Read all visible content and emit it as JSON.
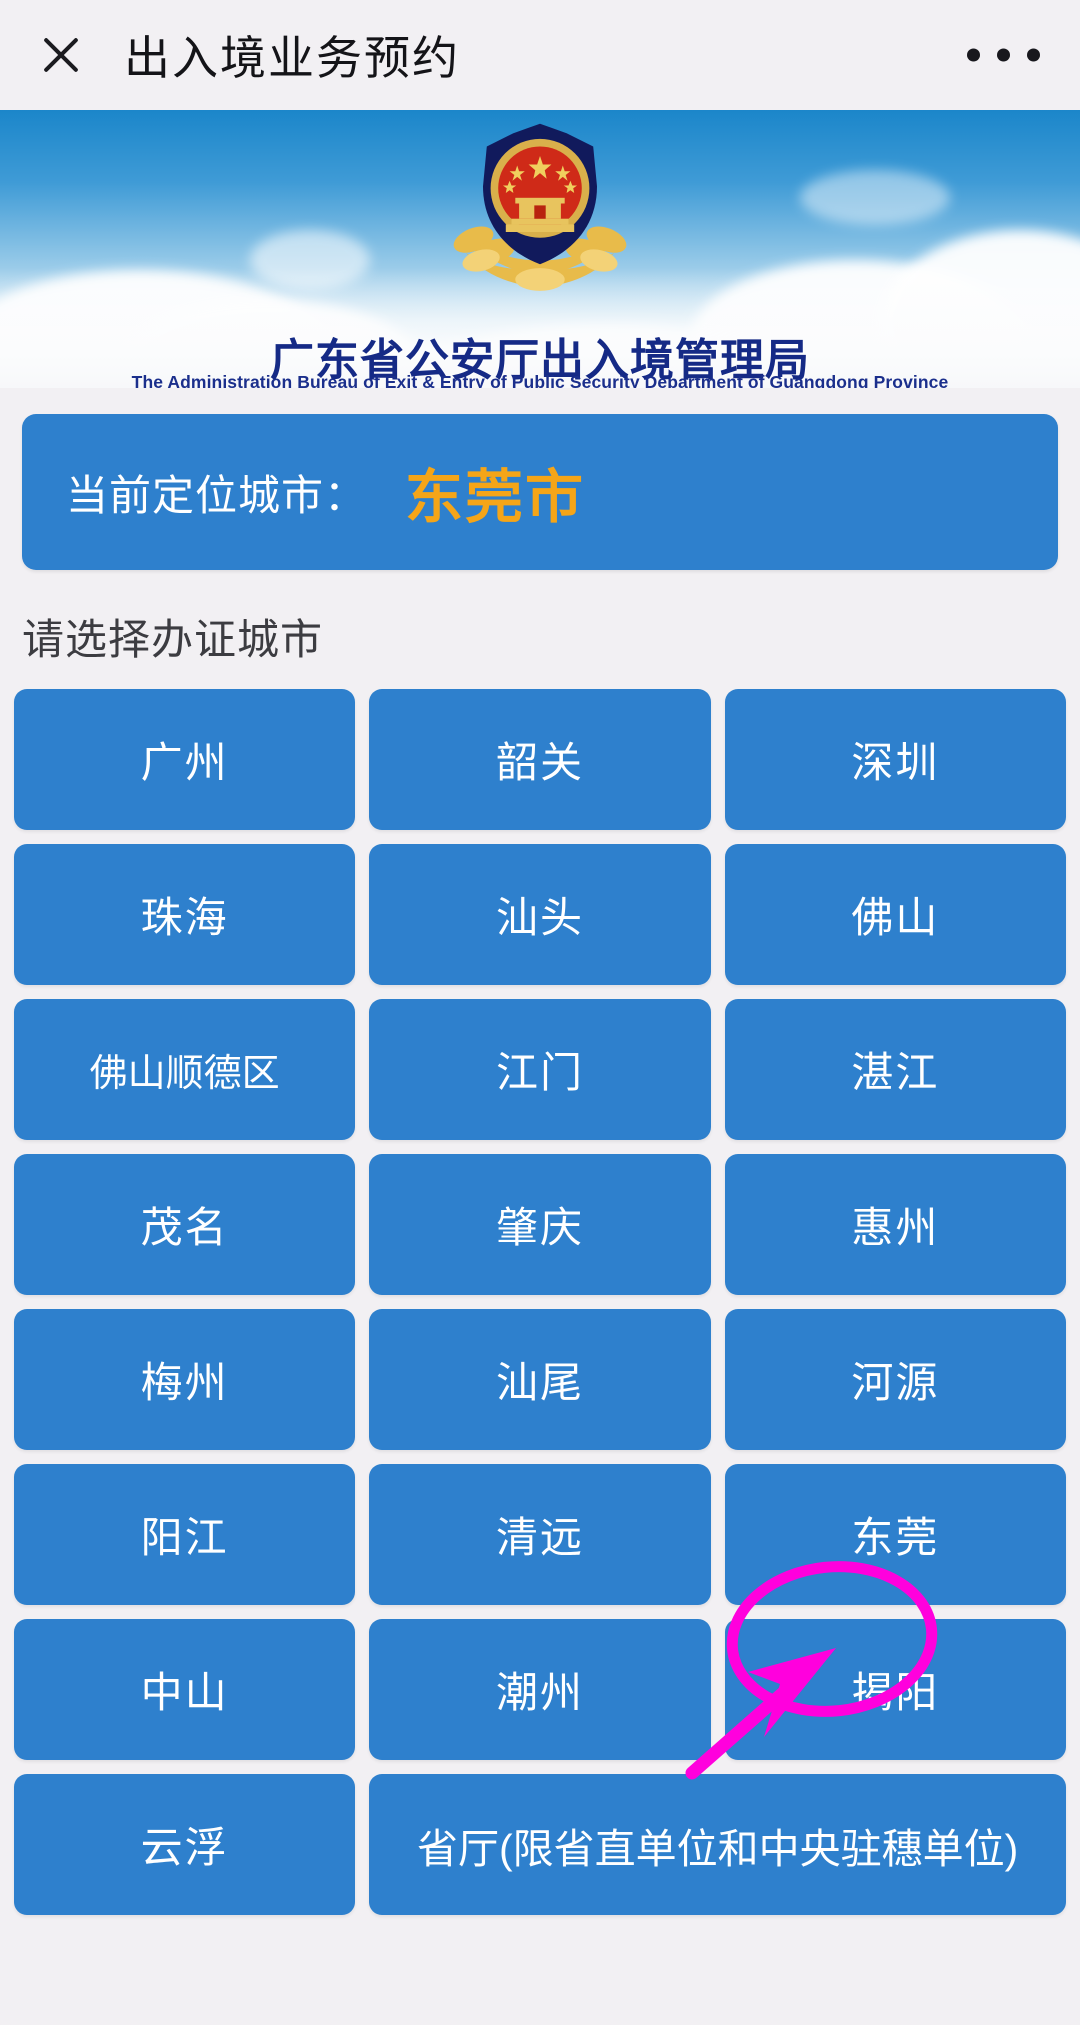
{
  "header": {
    "close_icon": "close-icon",
    "title": "出入境业务预约",
    "more_icon": "more-options-icon"
  },
  "banner": {
    "emblem_icon": "police-emblem-icon",
    "org_name_cn": "广东省公安厅出入境管理局",
    "org_name_en": "The Administration Bureau of Exit & Entry of Public Security Department of Guangdong Province",
    "sky_top_color": "#1b86ca",
    "sky_bottom_color": "#f7fafc"
  },
  "location": {
    "label": "当前定位城市：",
    "city": "东莞市",
    "bar_color": "#2e80cd",
    "city_color": "#f5a518"
  },
  "section": {
    "title": "请选择办证城市"
  },
  "cities": [
    {
      "label": "广州",
      "wide": false
    },
    {
      "label": "韶关",
      "wide": false
    },
    {
      "label": "深圳",
      "wide": false
    },
    {
      "label": "珠海",
      "wide": false
    },
    {
      "label": "汕头",
      "wide": false
    },
    {
      "label": "佛山",
      "wide": false
    },
    {
      "label": "佛山顺德区",
      "wide": false
    },
    {
      "label": "江门",
      "wide": false
    },
    {
      "label": "湛江",
      "wide": false
    },
    {
      "label": "茂名",
      "wide": false
    },
    {
      "label": "肇庆",
      "wide": false
    },
    {
      "label": "惠州",
      "wide": false
    },
    {
      "label": "梅州",
      "wide": false
    },
    {
      "label": "汕尾",
      "wide": false
    },
    {
      "label": "河源",
      "wide": false
    },
    {
      "label": "阳江",
      "wide": false
    },
    {
      "label": "清远",
      "wide": false
    },
    {
      "label": "东莞",
      "wide": false
    },
    {
      "label": "中山",
      "wide": false
    },
    {
      "label": "潮州",
      "wide": false
    },
    {
      "label": "揭阳",
      "wide": false
    },
    {
      "label": "云浮",
      "wide": false
    },
    {
      "label": "省厅(限省直单位和中央驻穗单位)",
      "wide": true
    }
  ],
  "annotation": {
    "color": "#ff00dd",
    "highlight_target": "东莞",
    "circle_icon": "annotation-ellipse",
    "arrow_icon": "annotation-arrow"
  },
  "theme": {
    "page_background": "#f2f0f3",
    "button_blue": "#2e80cd",
    "button_text": "#ffffff"
  }
}
